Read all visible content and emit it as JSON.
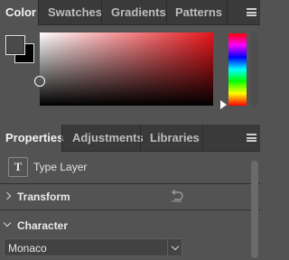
{
  "color_panel": {
    "tabs": [
      {
        "label": "Color",
        "active": true
      },
      {
        "label": "Swatches",
        "active": false
      },
      {
        "label": "Gradients",
        "active": false
      },
      {
        "label": "Patterns",
        "active": false
      }
    ],
    "foreground_color": "#4a4a4a",
    "background_color": "#000000",
    "hue_color": "#e8151b"
  },
  "properties_panel": {
    "tabs": [
      {
        "label": "Properties",
        "active": true
      },
      {
        "label": "Adjustments",
        "active": false
      },
      {
        "label": "Libraries",
        "active": false
      }
    ],
    "layer_type_label": "Type Layer",
    "layer_type_icon": "T",
    "transform_section": {
      "title": "Transform",
      "expanded": false
    },
    "character_section": {
      "title": "Character",
      "expanded": true
    },
    "font_family": "Monaco"
  }
}
